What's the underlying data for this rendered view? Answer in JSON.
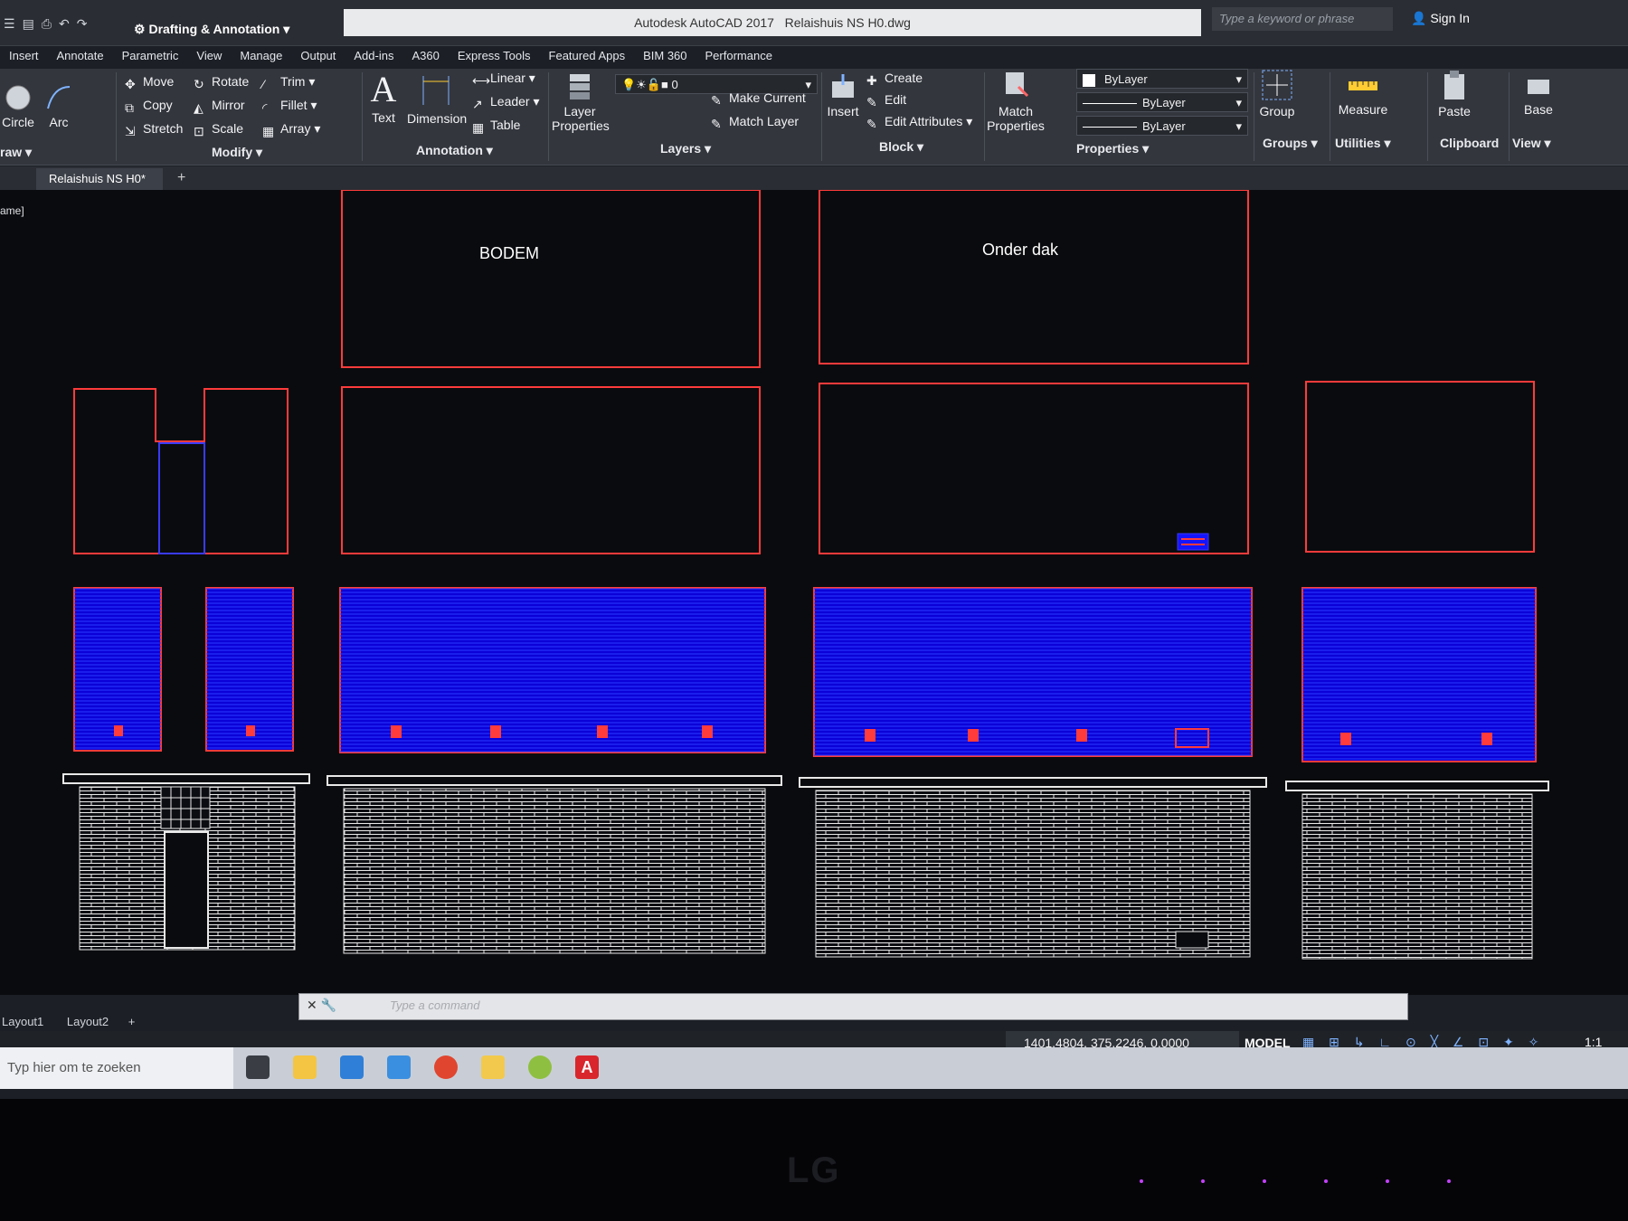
{
  "titlebar": {
    "workspace": "Drafting & Annotation",
    "app_title": "Autodesk AutoCAD 2017",
    "file_title": "Relaishuis NS H0.dwg",
    "search_placeholder": "Type a keyword or phrase",
    "sign_in": "Sign In"
  },
  "menu_tabs": [
    "Insert",
    "Annotate",
    "Parametric",
    "View",
    "Manage",
    "Output",
    "Add-ins",
    "A360",
    "Express Tools",
    "Featured Apps",
    "BIM 360",
    "Performance"
  ],
  "ribbon": {
    "draw": {
      "circle": "Circle",
      "arc": "Arc",
      "panel": "raw"
    },
    "modify": {
      "move": "Move",
      "rotate": "Rotate",
      "trim": "Trim",
      "copy": "Copy",
      "mirror": "Mirror",
      "fillet": "Fillet",
      "stretch": "Stretch",
      "scale": "Scale",
      "array": "Array",
      "panel": "Modify"
    },
    "annotation": {
      "text": "Text",
      "dimension": "Dimension",
      "linear": "Linear",
      "leader": "Leader",
      "table": "Table",
      "panel": "Annotation"
    },
    "layers": {
      "layer_properties": "Layer\nProperties",
      "current_layer": "0",
      "make_current": "Make Current",
      "match_layer": "Match Layer",
      "panel": "Layers"
    },
    "block": {
      "insert": "Insert",
      "create": "Create",
      "edit": "Edit",
      "edit_attributes": "Edit Attributes",
      "panel": "Block"
    },
    "properties": {
      "match_properties": "Match\nProperties",
      "color": "ByLayer",
      "linetype": "ByLayer",
      "lineweight": "ByLayer",
      "panel": "Properties"
    },
    "groups": {
      "group": "Group",
      "panel": "Groups"
    },
    "utilities": {
      "measure": "Measure",
      "panel": "Utilities"
    },
    "clipboard": {
      "paste": "Paste",
      "panel": "Clipboard"
    },
    "view": {
      "base": "Base",
      "panel": "View"
    }
  },
  "doc_tab": "Relaishuis NS H0*",
  "viewport_label": "ame]",
  "drawing": {
    "label_bodem": "BODEM",
    "label_onder_dak": "Onder dak"
  },
  "command_line": {
    "placeholder": "Type a command"
  },
  "layout_tabs": [
    "Layout1",
    "Layout2"
  ],
  "status": {
    "coordinates": "1401.4804, 375.2246, 0.0000",
    "mode": "MODEL",
    "scale": "1:1"
  },
  "taskbar": {
    "search_placeholder": "Typ hier om te zoeken"
  },
  "monitor_brand": "LG",
  "colors": {
    "outline": "#ff3b3b",
    "fill_blue": "#0b00d8",
    "hatch_white": "#e8e8e8",
    "canvas": "#0a0b0e"
  }
}
